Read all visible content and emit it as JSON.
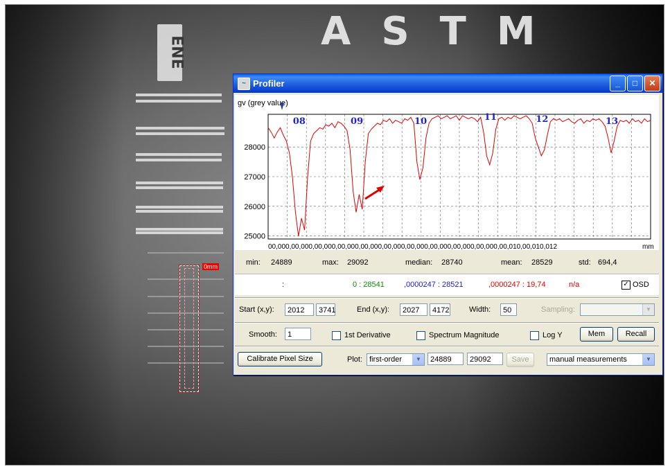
{
  "background": {
    "text_astm": "ASTM",
    "text_ene": "ENE",
    "roi_label": "0mm"
  },
  "window": {
    "title": "Profiler"
  },
  "plot": {
    "y_label": "gv (grey value)",
    "x_tick_labels": "00,000,00,000,00,000,00,000,00,000,00,000,00,000,00,000,00,000,00,000,00,010,00,010,012",
    "x_unit": "mm",
    "peak_labels": [
      "08",
      "09",
      "10",
      "11",
      "12",
      "13"
    ],
    "colors": {
      "line": "#e00000",
      "peak_labels": "#2020d0",
      "arrow": "#e00000"
    }
  },
  "chart_data": {
    "type": "line",
    "ylabel": "gv (grey value)",
    "xlabel": "mm",
    "ylim": [
      24900,
      29100
    ],
    "y_ticks": [
      25000,
      26000,
      27000,
      28000
    ],
    "grid": true,
    "annotations": [
      "08",
      "09",
      "10",
      "11",
      "12",
      "13"
    ],
    "series": [
      {
        "values": [
          28650,
          28500,
          28300,
          28500,
          28650,
          28400,
          28200,
          27800,
          27000,
          25800,
          25000,
          25600,
          25200,
          27000,
          28200,
          28450,
          28550,
          28650,
          28600,
          28750,
          28700,
          28800,
          28650,
          28850,
          28800,
          28700,
          28550,
          27900,
          26500,
          25800,
          26400,
          25900,
          27500,
          28450,
          28600,
          28700,
          28800,
          28750,
          28900,
          28850,
          28950,
          28800,
          28900,
          28850,
          28800,
          28950,
          28900,
          29000,
          28800,
          27500,
          26900,
          27300,
          28300,
          28800,
          28950,
          29000,
          29050,
          28950,
          29000,
          29050,
          28950,
          29000,
          29050,
          28900,
          29050,
          29000,
          28950,
          29000,
          28950,
          28850,
          29000,
          28500,
          27700,
          27400,
          27800,
          28600,
          28950,
          29000,
          28900,
          29000,
          28950,
          29050,
          29000,
          28950,
          29000,
          29050,
          28950,
          28800,
          28300,
          28000,
          27700,
          27900,
          28400,
          28850,
          28950,
          28900,
          28950,
          28850,
          28900,
          28950,
          28850,
          28800,
          28900,
          28950,
          28800,
          28900,
          28850,
          28950,
          28900,
          28950,
          28850,
          28700,
          28300,
          27800,
          28200,
          28700,
          28900,
          28850,
          28900,
          28800,
          28950,
          28850,
          28900,
          28800,
          28950,
          28850,
          28900
        ]
      }
    ]
  },
  "stats": {
    "min_label": "min:",
    "min_value": "24889",
    "max_label": "max:",
    "max_value": "29092",
    "median_label": "median:",
    "median_value": "28740",
    "mean_label": "mean:",
    "mean_value": "28529",
    "std_label": "std:",
    "std_value": "694,4"
  },
  "osd": {
    "colon": ":",
    "green_text": "0 : 28541",
    "blue_text": ",0000247 : 28521",
    "red_text": ",0000247 : 19,74",
    "na_text": "n/a",
    "osd_label": "OSD",
    "osd_checked": "✓"
  },
  "controls": {
    "start_label": "Start (x,y):",
    "start_x": "2012",
    "start_y": "3741",
    "end_label": "End (x,y):",
    "end_x": "2027",
    "end_y": "4172",
    "width_label": "Width:",
    "width_value": "50",
    "sampling_label": "Sampling:",
    "sampling_value": "",
    "smooth_label": "Smooth:",
    "smooth_value": "1",
    "first_derivative_label": "1st Derivative",
    "spectrum_label": "Spectrum Magnitude",
    "logy_label": "Log Y",
    "mem_label": "Mem",
    "recall_label": "Recall",
    "calibrate_label": "Calibrate Pixel Size",
    "plot_label": "Plot:",
    "plot_value": "first-order",
    "plot_min": "24889",
    "plot_max": "29092",
    "save_label": "Save",
    "mode_value": "manual measurements"
  }
}
